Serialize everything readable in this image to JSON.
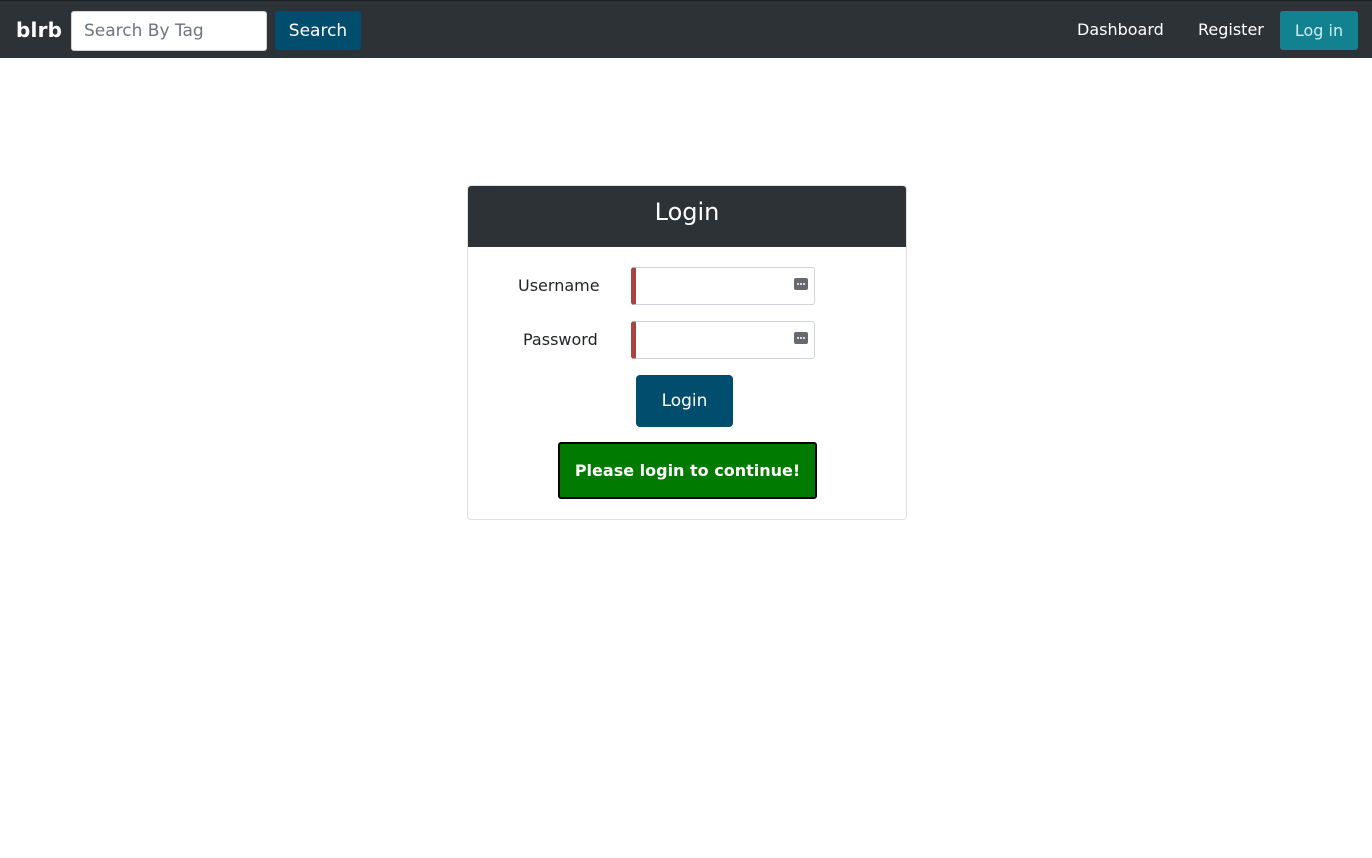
{
  "navbar": {
    "brand": "blrb",
    "search": {
      "placeholder": "Search By Tag",
      "value": ""
    },
    "search_button": "Search",
    "links": {
      "dashboard": "Dashboard",
      "register": "Register",
      "login": "Log in"
    }
  },
  "login_card": {
    "title": "Login",
    "username_label": "Username",
    "username_value": "",
    "password_label": "Password",
    "password_value": "",
    "submit_label": "Login",
    "message": "Please login to continue!"
  },
  "colors": {
    "navbar_bg": "#2d3236",
    "primary_button": "#004d6e",
    "login_link_bg": "#138290",
    "alert_bg": "#007a00",
    "invalid_border": "#a94442"
  },
  "icons": {
    "field_icon": "password-manager-key-icon"
  }
}
